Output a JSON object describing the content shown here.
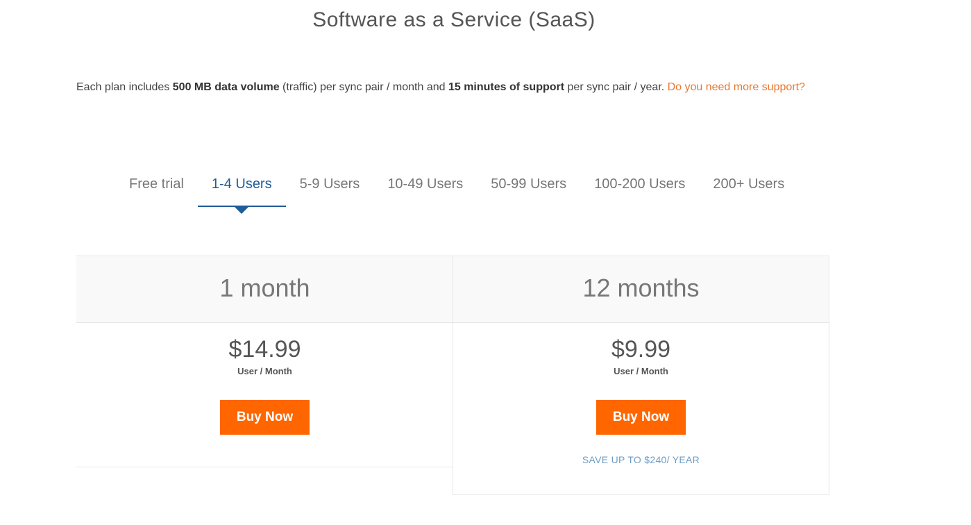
{
  "title": "Software as a Service (SaaS)",
  "intro": {
    "part1": "Each plan includes ",
    "bold1": "500 MB data volume",
    "part2": " (traffic) per sync pair / month and ",
    "bold2": "15 minutes of support",
    "part3": " per sync pair / year. ",
    "link": "Do you need more support?"
  },
  "tabs": [
    {
      "label": "Free trial",
      "active": false
    },
    {
      "label": "1-4 Users",
      "active": true
    },
    {
      "label": "5-9 Users",
      "active": false
    },
    {
      "label": "10-49 Users",
      "active": false
    },
    {
      "label": "50-99 Users",
      "active": false
    },
    {
      "label": "100-200 Users",
      "active": false
    },
    {
      "label": "200+ Users",
      "active": false
    }
  ],
  "plans": [
    {
      "duration": "1 month",
      "price": "$14.99",
      "unit": "User / Month",
      "button": "Buy Now",
      "note": ""
    },
    {
      "duration": "12 months",
      "price": "$9.99",
      "unit": "User / Month",
      "button": "Buy Now",
      "note": "SAVE UP TO $240/ YEAR"
    }
  ],
  "colors": {
    "accent": "#ff6600",
    "link": "#e8772e",
    "active_tab": "#1f5c99",
    "save_note": "#6d9dc5"
  }
}
